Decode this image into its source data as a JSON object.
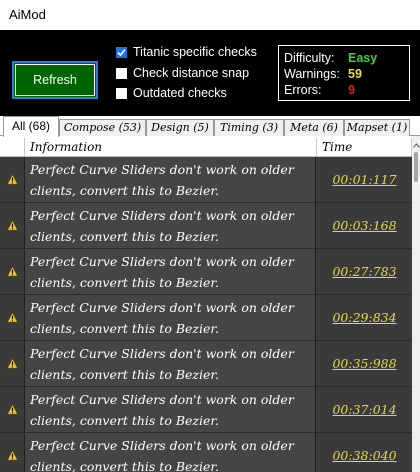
{
  "window": {
    "title": "AiMod"
  },
  "toolbar": {
    "refresh_label": "Refresh",
    "options": [
      {
        "label": "Titanic specific checks",
        "checked": true
      },
      {
        "label": "Check distance snap",
        "checked": false
      },
      {
        "label": "Outdated checks",
        "checked": false
      }
    ]
  },
  "stats": {
    "difficulty_label": "Difficulty:",
    "difficulty_value": "Easy",
    "difficulty_color": "#3cd23c",
    "warnings_label": "Warnings:",
    "warnings_value": "59",
    "warnings_color": "#f2e02a",
    "errors_label": "Errors:",
    "errors_value": "9",
    "errors_color": "#e01818"
  },
  "tabs": [
    {
      "label": "All (68)",
      "active": true
    },
    {
      "label": "Compose (53)",
      "active": false
    },
    {
      "label": "Design (5)",
      "active": false
    },
    {
      "label": "Timing (3)",
      "active": false
    },
    {
      "label": "Meta (6)",
      "active": false
    },
    {
      "label": "Mapset (1)",
      "active": false
    }
  ],
  "table": {
    "columns": [
      "Information",
      "Time"
    ],
    "rows": [
      {
        "severity": "warning-icon",
        "text_line1": "Perfect Curve Sliders don't work on older",
        "text_line2": "clients, convert this to Bezier.",
        "time": "00:01:117"
      },
      {
        "severity": "warning-icon",
        "text_line1": "Perfect Curve Sliders don't work on older",
        "text_line2": "clients, convert this to Bezier.",
        "time": "00:03:168"
      },
      {
        "severity": "warning-icon",
        "text_line1": "Perfect Curve Sliders don't work on older",
        "text_line2": "clients, convert this to Bezier.",
        "time": "00:27:783"
      },
      {
        "severity": "warning-icon",
        "text_line1": "Perfect Curve Sliders don't work on older",
        "text_line2": "clients, convert this to Bezier.",
        "time": "00:29:834"
      },
      {
        "severity": "warning-icon",
        "text_line1": "Perfect Curve Sliders don't work on older",
        "text_line2": "clients, convert this to Bezier.",
        "time": "00:35:988"
      },
      {
        "severity": "warning-icon",
        "text_line1": "Perfect Curve Sliders don't work on older",
        "text_line2": "clients, convert this to Bezier.",
        "time": "00:37:014"
      },
      {
        "severity": "warning-icon",
        "text_line1": "Perfect Curve Sliders don't work on older",
        "text_line2": "clients, convert this to Bezier.",
        "time": "00:38:040"
      }
    ]
  },
  "colors": {
    "accent_green": "#006400",
    "time_link": "#e5d83a",
    "checkbox_blue": "#1a73e8"
  }
}
